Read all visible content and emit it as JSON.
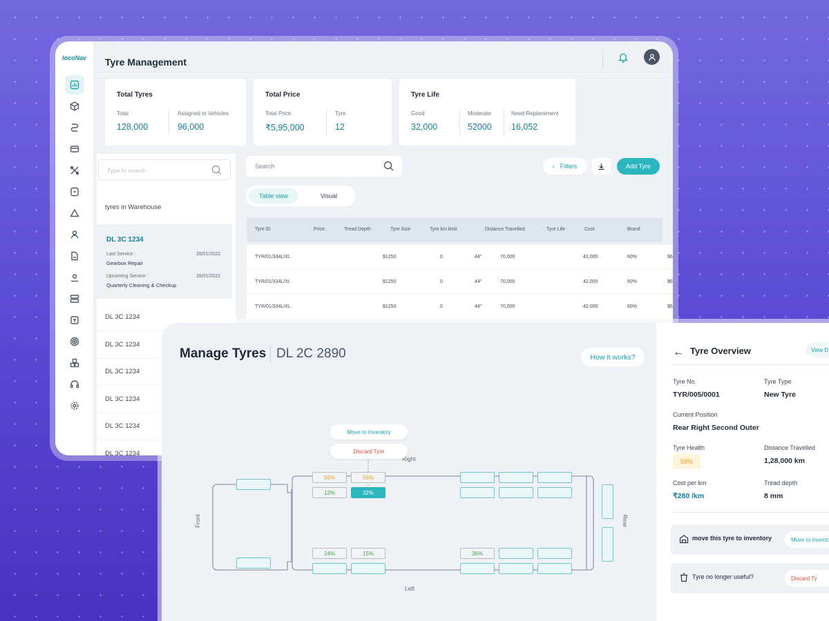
{
  "app": {
    "logo": "locoNav",
    "title": "Tyre Management"
  },
  "cards": [
    {
      "title": "Total Tyres",
      "items": [
        {
          "label": "Total",
          "value": "128,000"
        },
        {
          "label": "Assigned to Vehicles",
          "value": "96,000"
        }
      ]
    },
    {
      "title": "Total Price",
      "items": [
        {
          "label": "Total Price",
          "value": "₹5,95,000"
        },
        {
          "label": "Tyre",
          "value": "12"
        }
      ]
    },
    {
      "title": "Tyre Life",
      "items": [
        {
          "label": "Good",
          "value": "32,000"
        },
        {
          "label": "Moderate",
          "value": "52000"
        },
        {
          "label": "Need Replacement",
          "value": "16,052"
        }
      ]
    }
  ],
  "left_panel": {
    "search_placeholder": "Type to search",
    "warehouse_label": "tyres in Warehouse",
    "selected": {
      "vehicle": "DL 3C 1234",
      "last_service_label": "Last Service :",
      "last_service_date": "28/01/2022",
      "last_service_value": "Gearbox Repair",
      "upcoming_label": "Upcoming Service :",
      "upcoming_date": "28/01/2022",
      "upcoming_value": "Quarterly Cleaning & Checkup"
    },
    "vehicles": [
      "DL 3C 1234",
      "DL 3C 1234",
      "DL 3C 1234",
      "DL 3C 1234",
      "DL 3C 1234",
      "DL 3C 1234"
    ]
  },
  "toolbar": {
    "search_placeholder": "Search",
    "filters": "Filters",
    "add_tyre": "Add Tyre",
    "table_view": "Table view",
    "visual": "Visual"
  },
  "table": {
    "headers": [
      "Tyre ID",
      "Price",
      "Tread Depth",
      "Tyre Size",
      "Tyre km limit",
      "Distance Travelled",
      "Tyre Life",
      "Cost",
      "Brand"
    ],
    "rows": [
      [
        "TYR/01/334L/XL",
        "$1250",
        "0",
        "44\"",
        "70,000",
        "42,000",
        "60%",
        "$6"
      ],
      [
        "TYR/01/334L/XL",
        "$1250",
        "0",
        "44\"",
        "70,000",
        "42,000",
        "60%",
        "$6"
      ],
      [
        "TYR/01/334L/XL",
        "$1250",
        "0",
        "44\"",
        "70,000",
        "42,000",
        "60%",
        "$6"
      ]
    ]
  },
  "manage": {
    "title": "Manage Tyres",
    "vehicle": "DL 2C 2890",
    "how": "How it works?",
    "labels": {
      "front": "Front",
      "rear": "Rear",
      "left": "Left",
      "right": "Right"
    },
    "popup": {
      "move": "Move to Inventory",
      "discard": "Discard Tyre"
    },
    "tyres": {
      "r1a": "56%",
      "r1b": "56%",
      "r2a": "12%",
      "r2b": "32%",
      "l1a": "24%",
      "l1b": "15%",
      "l1c": "36%"
    }
  },
  "overview": {
    "title": "Tyre Overview",
    "view": "View D",
    "tyre_no_label": "Tyre No.",
    "tyre_no": "TYR/005/0001",
    "tyre_type_label": "Tyre Type",
    "tyre_type": "New Tyre",
    "position_label": "Current Position",
    "position": "Rear Right Second Outer",
    "health_label": "Tyre Health",
    "health": "58%",
    "distance_label": "Distance Travelled",
    "distance": "1,28,000 km",
    "cost_label": "Cost per km",
    "cost": "₹280 /km",
    "tread_label": "Tread depth",
    "tread": "8 mm",
    "move_text": "move this tyre to inventory",
    "move_btn": "Move to invento",
    "discard_text": "Tyre no longer useful?",
    "discard_btn": "Discard Ty"
  },
  "colors": {
    "accent": "#2bb5bf",
    "teal_text": "#147f93",
    "warning": "#e8a31c",
    "danger": "#e0433b",
    "good": "#3aaa47"
  }
}
